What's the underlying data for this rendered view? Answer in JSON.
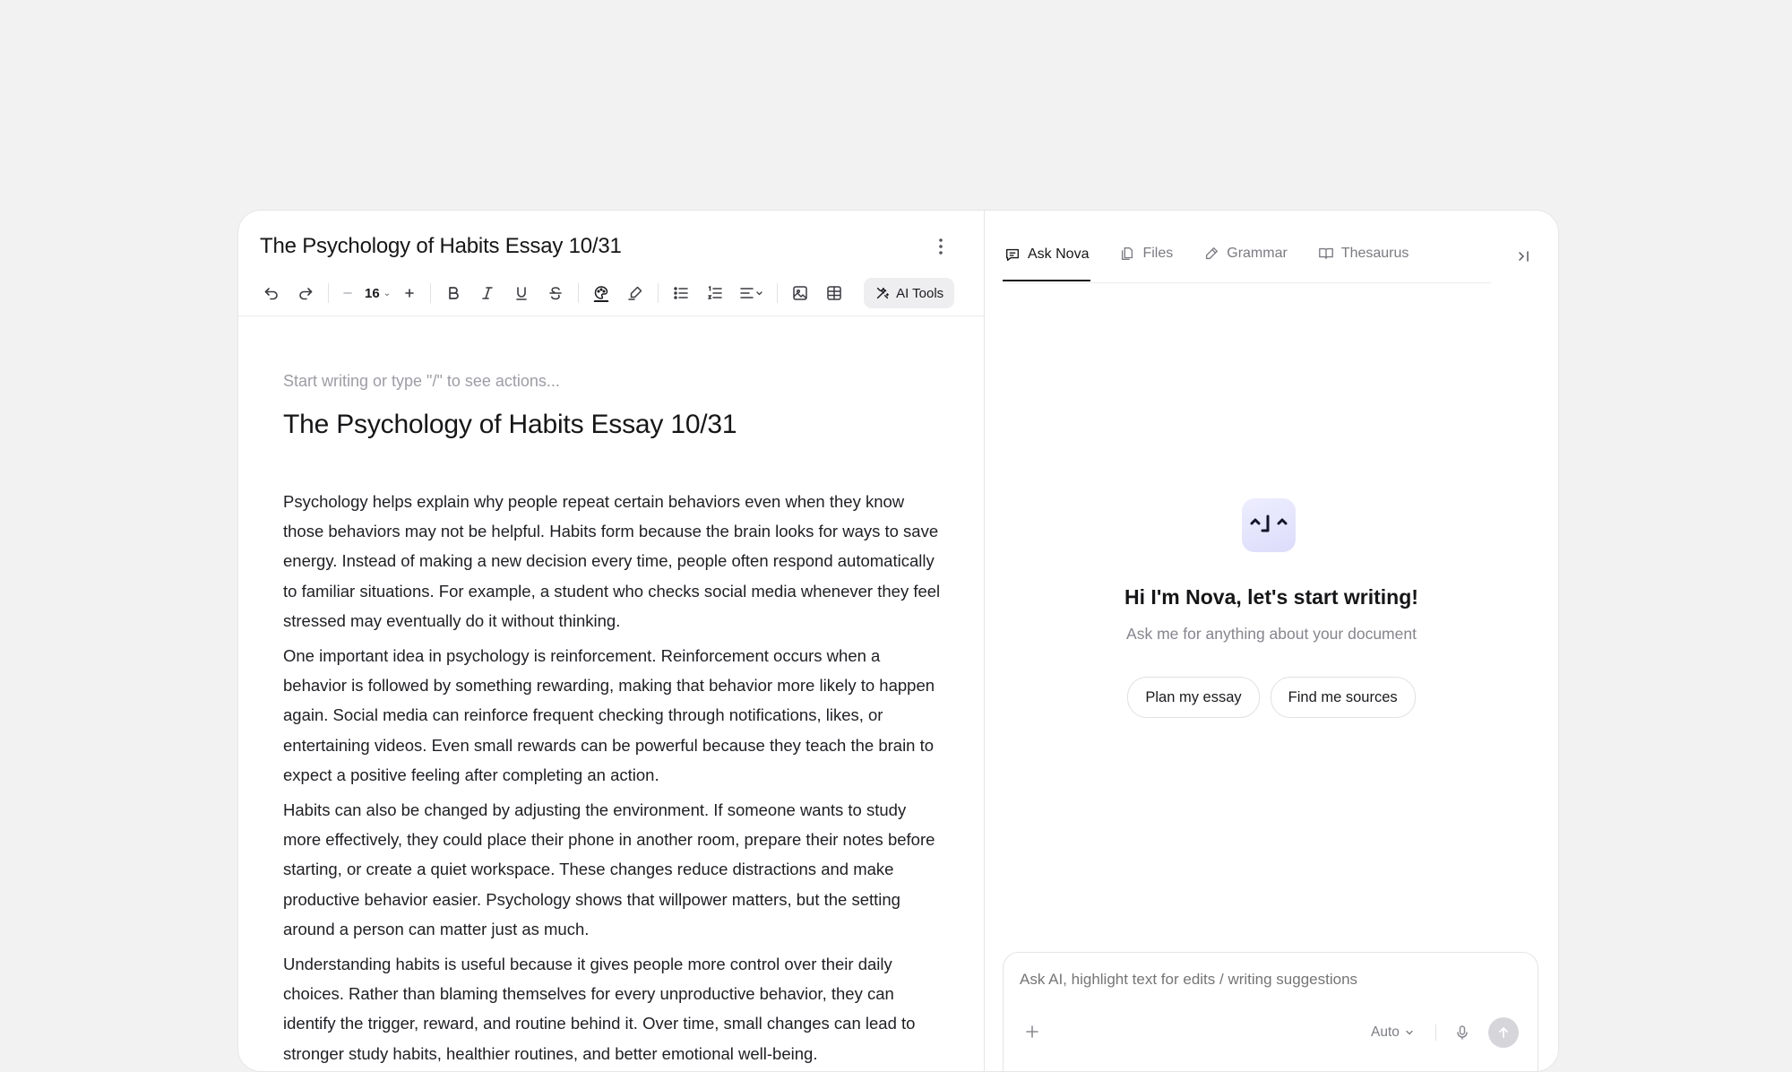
{
  "document": {
    "title": "The Psychology of Habits Essay 10/31",
    "placeholder": "Start writing or type \"/\" to see actions...",
    "heading": "The Psychology of Habits Essay 10/31",
    "paragraphs": [
      "Psychology helps explain why people repeat certain behaviors even when they know those behaviors may not be helpful. Habits form because the brain looks for ways to save energy. Instead of making a new decision every time, people often respond automatically to familiar situations. For example, a student who checks social media whenever they feel stressed may eventually do it without thinking.",
      "One important idea in psychology is reinforcement. Reinforcement occurs when a behavior is followed by something rewarding, making that behavior more likely to happen again. Social media can reinforce frequent checking through notifications, likes, or entertaining videos. Even small rewards can be powerful because they teach the brain to expect a positive feeling after completing an action.",
      "Habits can also be changed by adjusting the environment. If someone wants to study more effectively, they could place their phone in another room, prepare their notes before starting, or create a quiet workspace. These changes reduce distractions and make productive behavior easier. Psychology shows that willpower matters, but the setting around a person can matter just as much.",
      "Understanding habits is useful because it gives people more control over their daily choices. Rather than blaming themselves for every unproductive behavior, they can identify the trigger, reward, and routine behind it. Over time, small changes can lead to stronger study habits, healthier routines, and better emotional well-being."
    ]
  },
  "toolbar": {
    "font_size": "16",
    "ai_tools_label": "AI Tools",
    "icons": [
      "undo-icon",
      "redo-icon",
      "decrease-font-icon",
      "increase-font-icon",
      "bold-icon",
      "italic-icon",
      "underline-icon",
      "strikethrough-icon",
      "text-color-icon",
      "highlight-icon",
      "bullet-list-icon",
      "numbered-list-icon",
      "align-icon",
      "image-icon",
      "table-icon",
      "ai-tools-icon"
    ]
  },
  "assistant": {
    "tabs": [
      {
        "label": "Ask Nova",
        "icon": "chat-icon",
        "active": true
      },
      {
        "label": "Files",
        "icon": "files-icon",
        "active": false
      },
      {
        "label": "Grammar",
        "icon": "pen-icon",
        "active": false
      },
      {
        "label": "Thesaurus",
        "icon": "book-icon",
        "active": false
      }
    ],
    "greeting": "Hi I'm Nova, let's start writing!",
    "subgreeting": "Ask me for anything about your document",
    "suggestions": [
      "Plan my essay",
      "Find me sources"
    ],
    "composer": {
      "placeholder": "Ask AI, highlight text for edits / writing suggestions",
      "model": "Auto"
    }
  },
  "colors": {
    "background": "#f2f2f2",
    "panel": "#ffffff",
    "text": "#1b1b1f",
    "muted": "#85858d",
    "logo_tint": "#dcdcfb",
    "ai_tools_bg": "#eeeef0"
  }
}
